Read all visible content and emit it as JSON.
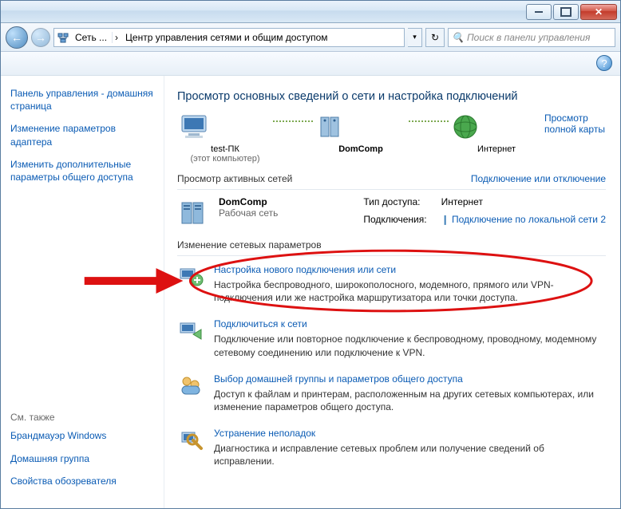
{
  "titlebar": {
    "close_label": "✕"
  },
  "addrbar": {
    "back_glyph": "←",
    "fwd_glyph": "→",
    "crumb1": "Сеть ...",
    "sep": "›",
    "crumb2": "Центр управления сетями и общим доступом",
    "drop_glyph": "▾",
    "refresh_glyph": "↻",
    "search_placeholder": "Поиск в панели управления",
    "search_icon": "🔍"
  },
  "sidebar": {
    "links": [
      "Панель управления - домашняя страница",
      "Изменение параметров адаптера",
      "Изменить дополнительные параметры общего доступа"
    ],
    "see_also_heading": "См. также",
    "see_also": [
      "Брандмауэр Windows",
      "Домашняя группа",
      "Свойства обозревателя"
    ]
  },
  "main": {
    "h1": "Просмотр основных сведений о сети и настройка подключений",
    "full_map_link": "Просмотр полной карты",
    "map": {
      "node1_label": "test-ПК",
      "node1_sub": "(этот компьютер)",
      "node2_label": "DomComp",
      "node3_label": "Интернет"
    },
    "active_heading": "Просмотр активных сетей",
    "active_link": "Подключение или отключение",
    "active": {
      "name": "DomComp",
      "category": "Рабочая сеть",
      "props": {
        "access_k": "Тип доступа:",
        "access_v": "Интернет",
        "conn_k": "Подключения:",
        "conn_v": "Подключение по локальной сети 2"
      }
    },
    "change_heading": "Изменение сетевых параметров",
    "tasks": [
      {
        "title": "Настройка нового подключения или сети",
        "desc": "Настройка беспроводного, широкополосного, модемного, прямого или VPN-подключения или же настройка маршрутизатора или точки доступа."
      },
      {
        "title": "Подключиться к сети",
        "desc": "Подключение или повторное подключение к беспроводному, проводному, модемному сетевому соединению или подключение к VPN."
      },
      {
        "title": "Выбор домашней группы и параметров общего доступа",
        "desc": "Доступ к файлам и принтерам, расположенным на других сетевых компьютерах, или изменение параметров общего доступа."
      },
      {
        "title": "Устранение неполадок",
        "desc": "Диагностика и исправление сетевых проблем или получение сведений об исправлении."
      }
    ],
    "help_glyph": "?"
  }
}
